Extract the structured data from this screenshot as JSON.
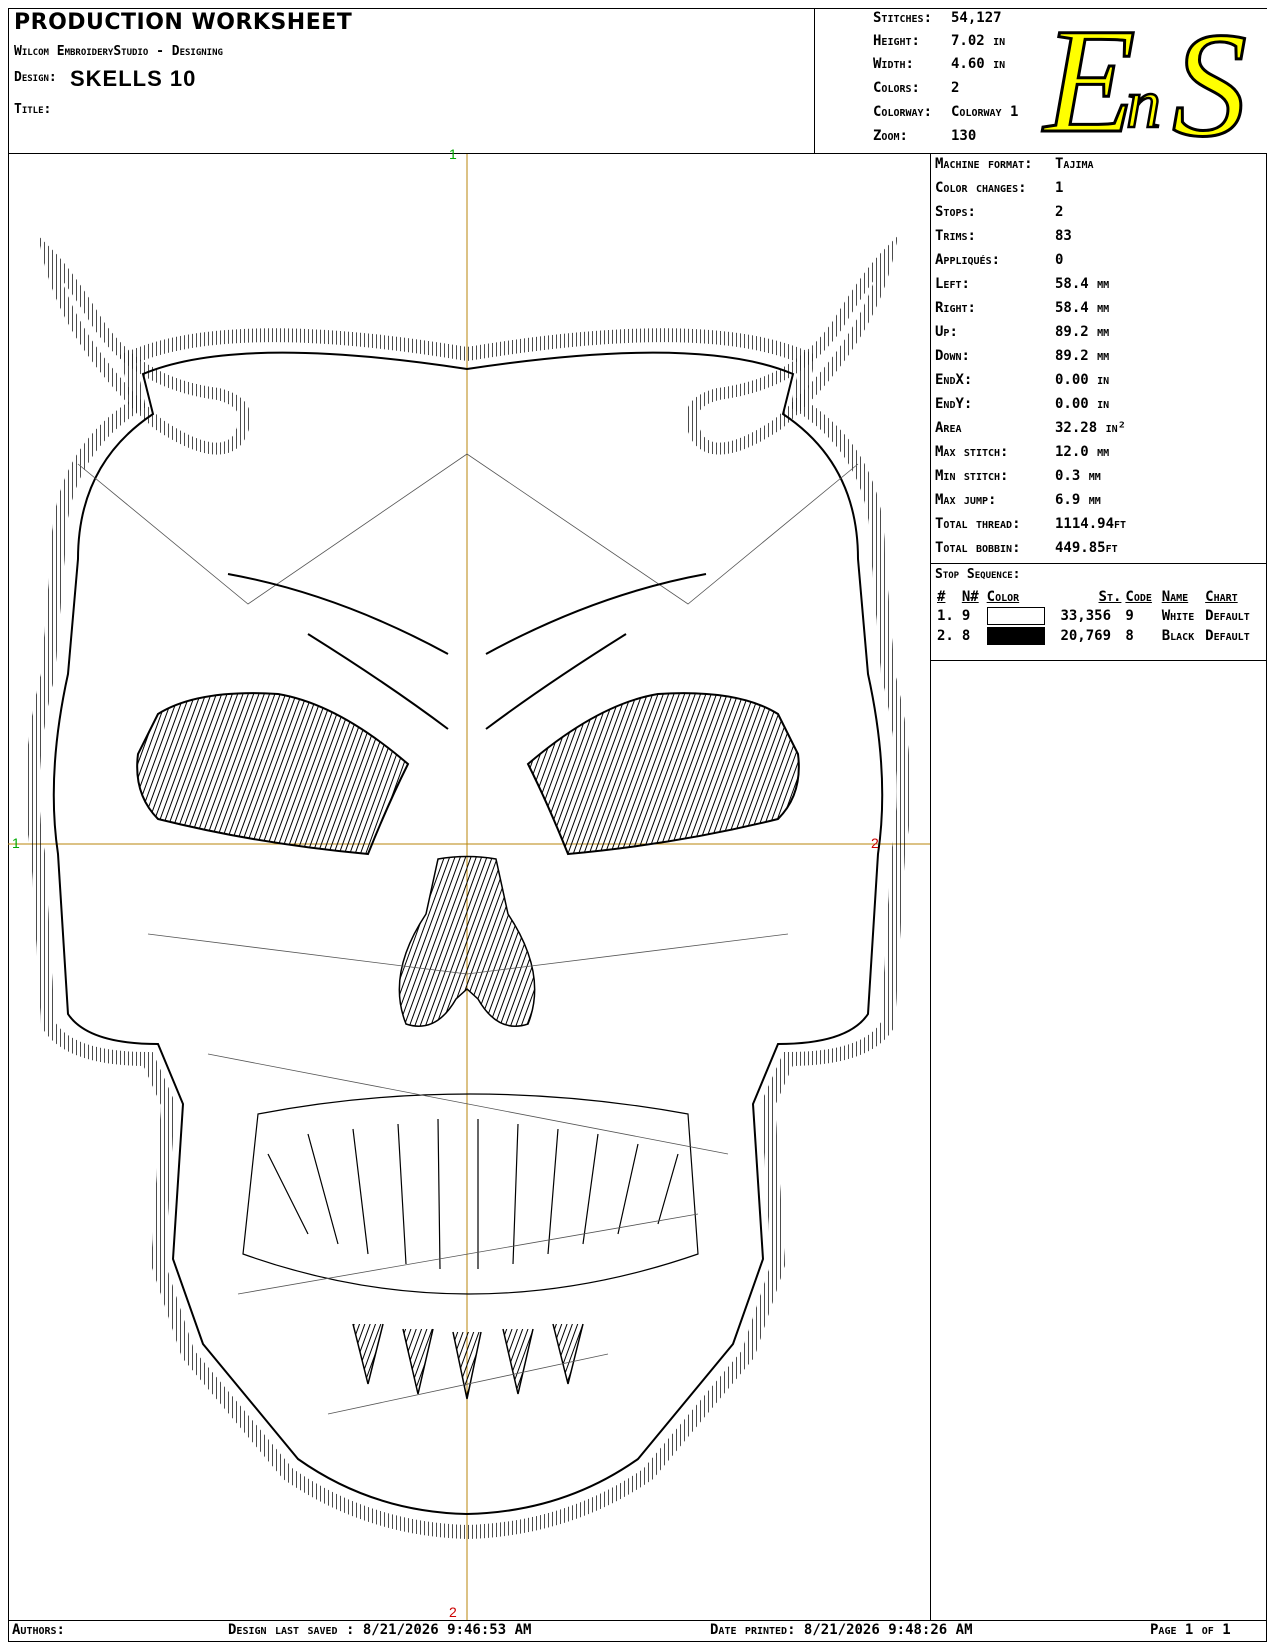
{
  "header": {
    "title": "PRODUCTION WORKSHEET",
    "software": "Wilcom EmbroideryStudio - Designing",
    "design_label": "Design:",
    "design_name": "SKELLS  10",
    "title_label": "Title:"
  },
  "stats": [
    {
      "label": "Stitches:",
      "value": "54,127"
    },
    {
      "label": "Height:",
      "value": "7.02 in"
    },
    {
      "label": "Width:",
      "value": "4.60 in"
    },
    {
      "label": "Colors:",
      "value": "2"
    },
    {
      "label": "Colorway:",
      "value": "Colorway 1"
    },
    {
      "label": "Zoom:",
      "value": "130"
    }
  ],
  "logo": {
    "text": "EnS",
    "fill": "#ffff00",
    "stroke": "#000000"
  },
  "machine": [
    {
      "label": "Machine format:",
      "value": "Tajima"
    },
    {
      "label": "Color changes:",
      "value": "1"
    },
    {
      "label": "Stops:",
      "value": "2"
    },
    {
      "label": "Trims:",
      "value": "83"
    },
    {
      "label": "Appliqués:",
      "value": "0"
    },
    {
      "label": "Left:",
      "value": "58.4 mm"
    },
    {
      "label": "Right:",
      "value": "58.4 mm"
    },
    {
      "label": "Up:",
      "value": "89.2 mm"
    },
    {
      "label": "Down:",
      "value": "89.2 mm"
    },
    {
      "label": "EndX:",
      "value": "0.00 in"
    },
    {
      "label": "EndY:",
      "value": "0.00 in"
    },
    {
      "label": "Area",
      "value": "32.28 in²"
    },
    {
      "label": "Max stitch:",
      "value": "12.0 mm"
    },
    {
      "label": "Min stitch:",
      "value": "0.3 mm"
    },
    {
      "label": "Max jump:",
      "value": "6.9 mm"
    },
    {
      "label": "Total thread:",
      "value": "1114.94ft"
    },
    {
      "label": "Total bobbin:",
      "value": "449.85ft"
    }
  ],
  "stop_sequence": {
    "heading": "Stop Sequence:",
    "columns": [
      "#",
      "N#",
      "Color",
      "St.",
      "Code",
      "Name",
      "Chart"
    ],
    "rows": [
      {
        "num": "1.",
        "n": "9",
        "color": "#ffffff",
        "stitches": "33,356",
        "code": "9",
        "name": "White",
        "chart": "Default"
      },
      {
        "num": "2.",
        "n": "8",
        "color": "#000000",
        "stitches": "20,769",
        "code": "8",
        "name": "Black",
        "chart": "Default"
      }
    ]
  },
  "axes": {
    "top": "1",
    "left": "1",
    "right": "2",
    "bottom": "2",
    "axis_color": "#b8860b",
    "label_top_color": "#00aa00",
    "label_left_color": "#00aa00",
    "label_right_color": "#cc0000",
    "label_bottom_color": "#cc0000"
  },
  "footer": {
    "authors": "Authors:",
    "last_saved": "Design last saved : 8/21/2026 9:46:53 AM",
    "printed": "Date printed: 8/21/2026 9:48:26 AM",
    "page": "Page 1 of 1"
  }
}
